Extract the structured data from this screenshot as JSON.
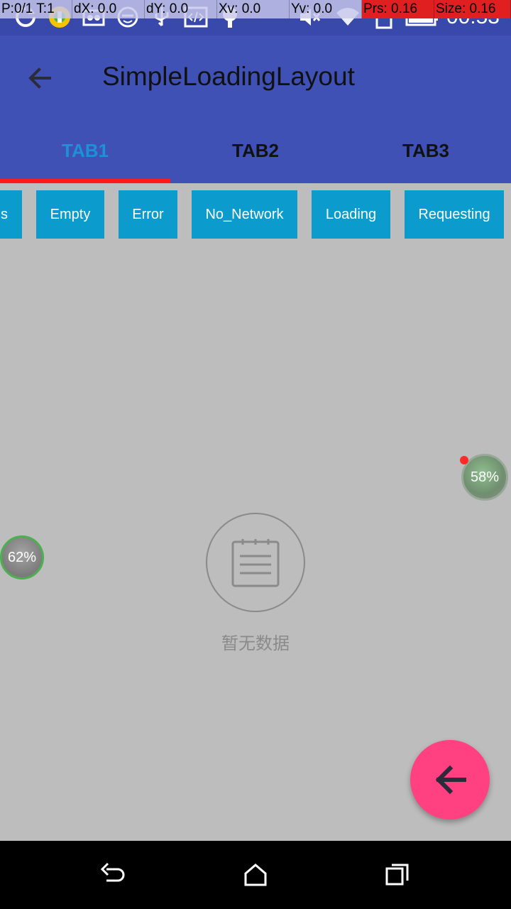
{
  "status_bar": {
    "overlay": [
      "P:0/1 T:1",
      "dX: 0.0",
      "dY: 0.0",
      "Xv: 0.0",
      "Yv: 0.0",
      "Prs: 0.16",
      "Size: 0.16"
    ],
    "clock": "00:53",
    "icons": [
      "sync-icon",
      "app-icon",
      "debug-icon",
      "face-icon",
      "usb-icon",
      "code-icon",
      "lightbulb-icon",
      "mute-icon",
      "wifi-icon",
      "sd-card-icon",
      "battery-icon"
    ]
  },
  "app_bar": {
    "title": "SimpleLoadingLayout",
    "back_icon": "arrow-back-icon"
  },
  "tabs": [
    {
      "label": "TAB1",
      "active": true
    },
    {
      "label": "TAB2",
      "active": false
    },
    {
      "label": "TAB3",
      "active": false
    }
  ],
  "buttons": [
    "s",
    "Empty",
    "Error",
    "No_Network",
    "Loading",
    "Requesting"
  ],
  "empty_state": {
    "icon": "notepad-icon",
    "text": "暂无数据"
  },
  "widgets": {
    "left_percent": "62%",
    "right_percent": "58%"
  },
  "fab": {
    "icon": "arrow-back-icon"
  },
  "nav_bar": {
    "icons": [
      "back-icon",
      "home-icon",
      "recents-icon"
    ]
  },
  "colors": {
    "primary": "#3f51b5",
    "status_bar": "#3949ab",
    "accent": "#ff4081",
    "tab_indicator": "#ff1a1a",
    "active_tab": "#1e90d8",
    "button": "#0b9ccd",
    "background": "#bdbdbd"
  }
}
